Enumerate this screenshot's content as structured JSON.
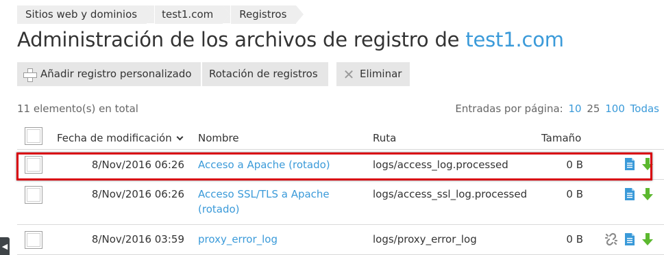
{
  "breadcrumb": [
    "Sitios web y dominios",
    "test1.com",
    "Registros"
  ],
  "title": {
    "text": "Administración de los archivos de registro de ",
    "site": "test1.com"
  },
  "toolbar": {
    "add_label": "Añadir registro personalizado",
    "rotation_label": "Rotación de registros",
    "delete_label": "Eliminar"
  },
  "summary": {
    "total": "11 elemento(s) en total",
    "per_page_label": "Entradas por página:",
    "per_page_options": [
      "10",
      "25",
      "100",
      "Todas"
    ],
    "per_page_selected": "25"
  },
  "table": {
    "headers": {
      "date": "Fecha de modificación",
      "name": "Nombre",
      "path": "Ruta",
      "size": "Tamaño"
    },
    "rows": [
      {
        "date": "8/Nov/2016 06:26",
        "name": "Acceso a Apache (rotado)",
        "path": "logs/access_log.processed",
        "size": "0 B",
        "actions": [
          "doc-icon",
          "download-icon"
        ],
        "highlighted": true
      },
      {
        "date": "8/Nov/2016 06:26",
        "name": "Acceso SSL/TLS a Apache (rotado)",
        "path": "logs/access_ssl_log.processed",
        "size": "0 B",
        "actions": [
          "doc-icon",
          "download-icon"
        ],
        "highlighted": false
      },
      {
        "date": "8/Nov/2016 03:59",
        "name": "proxy_error_log",
        "path": "logs/proxy_error_log",
        "size": "0 B",
        "actions": [
          "unlink-icon",
          "doc-icon",
          "download-icon"
        ],
        "highlighted": false
      }
    ]
  },
  "colors": {
    "link": "#3a9ad9",
    "highlight_border": "#d8000c",
    "download_icon": "#5cb82f",
    "doc_icon": "#3a9ad9",
    "button_bg": "#e6e6e6"
  }
}
